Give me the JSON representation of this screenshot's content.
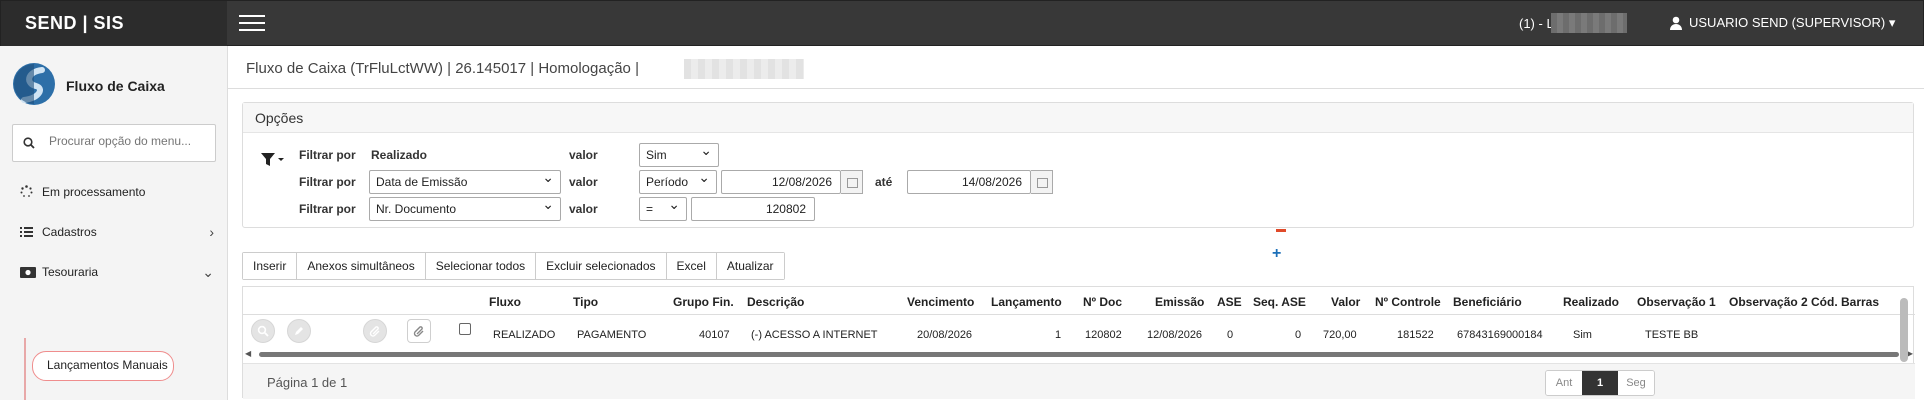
{
  "app": {
    "brand": "SEND | SIS",
    "company_prefix": "(1) - L",
    "user": "USUARIO SEND (SUPERVISOR)"
  },
  "sidebar": {
    "module_title": "Fluxo de Caixa",
    "search_placeholder": "Procurar opção do menu...",
    "items": [
      {
        "label": "Em processamento",
        "icon": "spinner-icon"
      },
      {
        "label": "Cadastros",
        "icon": "list-icon"
      },
      {
        "label": "Tesouraria",
        "icon": "money-icon"
      }
    ],
    "subitem": "Lançamentos Manuais"
  },
  "breadcrumb": "Fluxo de Caixa (TrFluLctWW) | 26.145017 | Homologação |",
  "options": {
    "title": "Opções",
    "filter_label": "Filtrar por",
    "valor_label": "valor",
    "ate_label": "até",
    "rows": [
      {
        "field": "Realizado",
        "value": "Sim"
      },
      {
        "field": "Data de Emissão",
        "operator": "Período",
        "from": "12/08/2026",
        "to": "14/08/2026"
      },
      {
        "field": "Nr. Documento",
        "operator": "=",
        "value": "120802"
      }
    ]
  },
  "toolbar": [
    "Inserir",
    "Anexos simultâneos",
    "Selecionar todos",
    "Excluir selecionados",
    "Excel",
    "Atualizar"
  ],
  "grid": {
    "columns": [
      "Fluxo",
      "Tipo",
      "Grupo Fin.",
      "Descrição",
      "Vencimento",
      "Lançamento",
      "Nº Doc",
      "Emissão",
      "ASE",
      "Seq. ASE",
      "Valor",
      "Nº Controle",
      "Beneficiário",
      "Realizado",
      "Observação 1",
      "Observação 2",
      "Cód. Barras"
    ],
    "rows": [
      {
        "cells": [
          "REALIZADO",
          "PAGAMENTO",
          "40107",
          "(-) ACESSO A INTERNET",
          "20/08/2026",
          "1",
          "120802",
          "12/08/2026",
          "0",
          "0",
          "720,00",
          "181522",
          "67843169000184",
          "Sim",
          "TESTE BB",
          "",
          ""
        ]
      }
    ]
  },
  "pager": {
    "text": "Página 1 de 1",
    "prev": "Ant",
    "current": "1",
    "next": "Seg"
  }
}
